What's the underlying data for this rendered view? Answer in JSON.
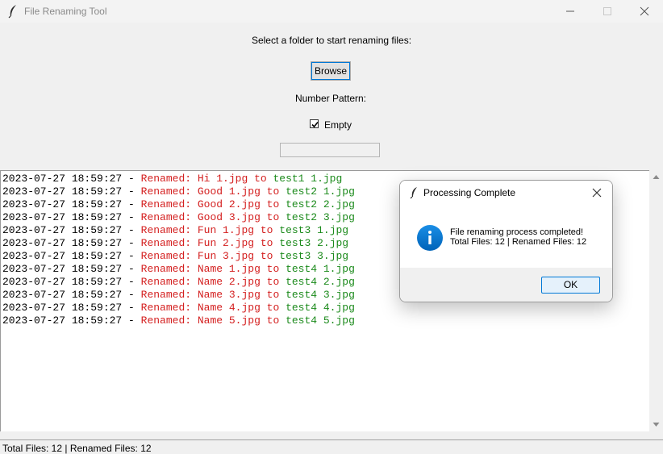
{
  "window": {
    "title": "File Renaming Tool",
    "icon": "feather-icon",
    "controls": [
      "minimize-icon",
      "maximize-icon",
      "close-icon"
    ]
  },
  "main": {
    "prompt": "Select a folder to start renaming files:",
    "browse_label": "Browse",
    "pattern_label": "Number Pattern:",
    "empty_checkbox": {
      "label": "Empty",
      "checked": true
    },
    "pattern_input_value": ""
  },
  "log": {
    "colors": {
      "timestamp": "#000000",
      "renamed": "#d42020",
      "new_name": "#1b8a1b"
    },
    "lines": [
      {
        "ts": "2023-07-27 18:59:27 - ",
        "old": "Renamed: Hi 1.jpg to ",
        "new": "test1 1.jpg"
      },
      {
        "ts": "2023-07-27 18:59:27 - ",
        "old": "Renamed: Good 1.jpg to ",
        "new": "test2 1.jpg"
      },
      {
        "ts": "2023-07-27 18:59:27 - ",
        "old": "Renamed: Good 2.jpg to ",
        "new": "test2 2.jpg"
      },
      {
        "ts": "2023-07-27 18:59:27 - ",
        "old": "Renamed: Good 3.jpg to ",
        "new": "test2 3.jpg"
      },
      {
        "ts": "2023-07-27 18:59:27 - ",
        "old": "Renamed: Fun 1.jpg to ",
        "new": "test3 1.jpg"
      },
      {
        "ts": "2023-07-27 18:59:27 - ",
        "old": "Renamed: Fun 2.jpg to ",
        "new": "test3 2.jpg"
      },
      {
        "ts": "2023-07-27 18:59:27 - ",
        "old": "Renamed: Fun 3.jpg to ",
        "new": "test3 3.jpg"
      },
      {
        "ts": "2023-07-27 18:59:27 - ",
        "old": "Renamed: Name 1.jpg to ",
        "new": "test4 1.jpg"
      },
      {
        "ts": "2023-07-27 18:59:27 - ",
        "old": "Renamed: Name 2.jpg to ",
        "new": "test4 2.jpg"
      },
      {
        "ts": "2023-07-27 18:59:27 - ",
        "old": "Renamed: Name 3.jpg to ",
        "new": "test4 3.jpg"
      },
      {
        "ts": "2023-07-27 18:59:27 - ",
        "old": "Renamed: Name 4.jpg to ",
        "new": "test4 4.jpg"
      },
      {
        "ts": "2023-07-27 18:59:27 - ",
        "old": "Renamed: Name 5.jpg to ",
        "new": "test4 5.jpg"
      }
    ]
  },
  "status": {
    "text": "Total Files: 12 | Renamed Files: 12"
  },
  "dialog": {
    "title": "Processing Complete",
    "icon": "info-icon",
    "accent": "#0078d7",
    "message_line1": "File renaming process completed!",
    "message_line2": "Total Files: 12 | Renamed Files: 12",
    "ok_label": "OK"
  }
}
